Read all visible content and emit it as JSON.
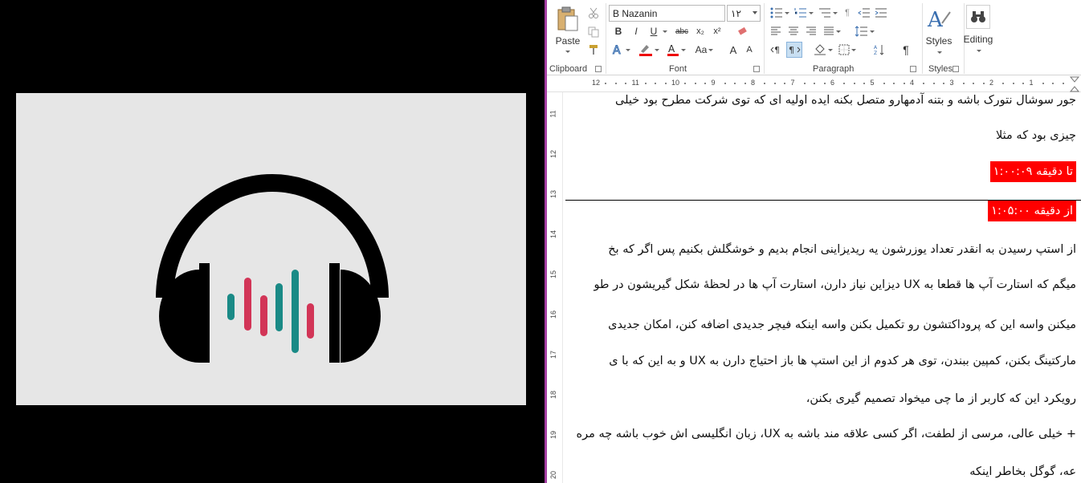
{
  "ribbon": {
    "clipboard": {
      "label": "Clipboard",
      "paste_label": "Paste"
    },
    "font": {
      "label": "Font",
      "font_name": "B Nazanin",
      "font_size": "۱۲",
      "bold": "B",
      "italic": "I",
      "underline": "U",
      "strike": "abc",
      "subscript": "x₂",
      "superscript": "x²",
      "change_case": "Aa",
      "grow": "A",
      "shrink": "A"
    },
    "paragraph": {
      "label": "Paragraph"
    },
    "styles": {
      "label": "Styles",
      "button_label": "Styles"
    },
    "editing": {
      "button_label": "Editing"
    }
  },
  "ruler": {
    "numbers": [
      "12",
      "11",
      "10",
      "9",
      "8",
      "7",
      "6",
      "5",
      "4",
      "3",
      "2",
      "1"
    ]
  },
  "vruler": {
    "numbers": [
      "11",
      "12",
      "13",
      "14",
      "15",
      "16",
      "17",
      "18",
      "19",
      "20"
    ]
  },
  "document": {
    "lines": [
      "جور سوشال نتورک باشه و بتنه آدمهارو متصل بکنه ایده اولیه ای که توی شرکت مطرح بود خیلی",
      "چیزی بود که مثلا",
      "تا دقیقه ۱:۰۰:۰۹",
      "از دقیقه ۱:۰۵:۰۰",
      "از استپ رسیدن به انقدر تعداد یوزرشون یه ریدیزاینی انجام بدیم  و خوشگلش بکنیم پس اگر که بخ",
      "میگم که استارت آپ ها قطعا به UX دیزاین نیاز دارن، استارت آپ ها در لحظهٔ شکل گیریشون در طو",
      "میکنن واسه این که پروداکتشون رو تکمیل بکنن واسه اینکه فیچر جدیدی اضافه کنن، امکان جدیدی",
      "مارکتینگ بکنن، کمپین ببندن، توی هر کدوم از این استپ ها باز احتیاج دارن به UX و به این که با ی",
      "رویکرد این که کاربر از ما چی میخواد تصمیم گیری بکنن،",
      "+ خیلی عالی، مرسی از لطفت، اگر کسی علاقه مند باشه به UX، زبان انگلیسی اش خوب باشه چه مره",
      "عه، گوگل بخاطر اینکه"
    ]
  },
  "colors": {
    "highlight_red": "#ff0000",
    "teal": "#1a8a86",
    "crimson": "#d23557",
    "window_accent": "#a53ea3"
  }
}
